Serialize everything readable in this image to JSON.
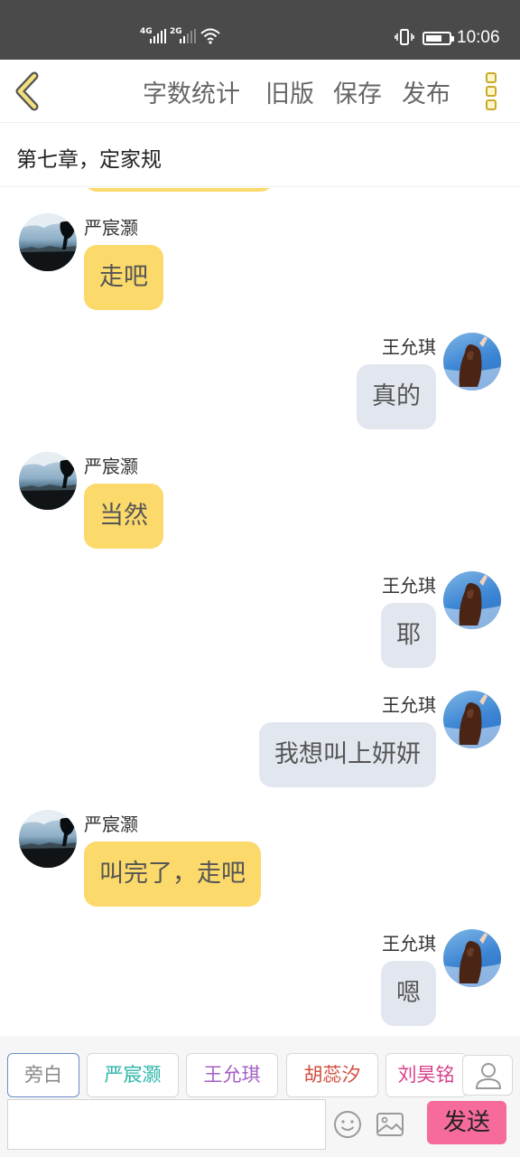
{
  "status_bar": {
    "network_1": "4G",
    "network_2": "2G",
    "time": "10:06",
    "battery_percent": 70
  },
  "toolbar": {
    "back_icon": "chevron-left-icon",
    "word_count_label": "字数统计",
    "old_version_label": "旧版",
    "save_label": "保存",
    "publish_label": "发布",
    "more_icon": "vertical-dots-icon",
    "accent_color": "#c9a82a"
  },
  "chapter": {
    "title": "第七章，定家规"
  },
  "messages": [
    {
      "side": "left",
      "sender": "严宸灏",
      "text": "走吧"
    },
    {
      "side": "right",
      "sender": "王允琪",
      "text": "真的"
    },
    {
      "side": "left",
      "sender": "严宸灏",
      "text": "当然"
    },
    {
      "side": "right",
      "sender": "王允琪",
      "text": "耶"
    },
    {
      "side": "right",
      "sender": "王允琪",
      "text": "我想叫上妍妍"
    },
    {
      "side": "left",
      "sender": "严宸灏",
      "text": "叫完了，走吧"
    },
    {
      "side": "right",
      "sender": "王允琪",
      "text": "嗯"
    }
  ],
  "bubble_colors": {
    "left": "#fbd96b",
    "right": "#e2e7ef"
  },
  "roles": [
    {
      "name": "旁白",
      "color": "#888888",
      "selected": true
    },
    {
      "name": "严宸灏",
      "color": "#2bb5a8",
      "selected": false
    },
    {
      "name": "王允琪",
      "color": "#a45ec4",
      "selected": false
    },
    {
      "name": "胡蕊汐",
      "color": "#d24c3c",
      "selected": false
    },
    {
      "name": "刘昊铭",
      "color": "#d8408c",
      "selected": false
    }
  ],
  "role_manage_icon": "person-icon",
  "composer": {
    "input_value": "",
    "emoji_icon": "smiley-icon",
    "image_icon": "image-icon",
    "send_label": "发送",
    "send_color": "#f76b9c"
  }
}
